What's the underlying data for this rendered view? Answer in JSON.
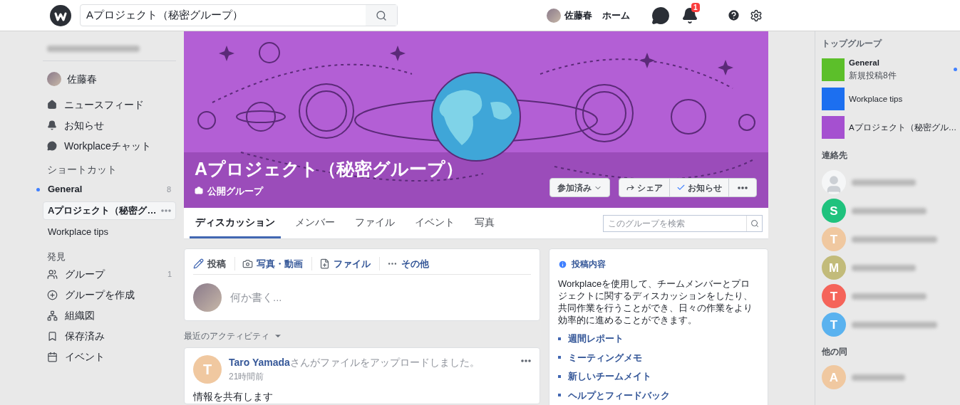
{
  "topbar": {
    "search_value": "Aプロジェクト（秘密グループ）",
    "user_name": "佐藤春",
    "home": "ホーム",
    "notification_badge": "1"
  },
  "sidebar": {
    "user_name": "佐藤春",
    "nav": [
      {
        "label": "ニュースフィード"
      },
      {
        "label": "お知らせ"
      },
      {
        "label": "Workplaceチャット"
      }
    ],
    "shortcuts_title": "ショートカット",
    "shortcuts": [
      {
        "label": "General",
        "count": "8",
        "unread": true,
        "selected": false
      },
      {
        "label": "Aプロジェクト（秘密グ…",
        "unread": false,
        "selected": true
      },
      {
        "label": "Workplace tips",
        "unread": false,
        "selected": false
      }
    ],
    "discover_title": "発見",
    "discover": [
      {
        "label": "グループ",
        "count": "1"
      },
      {
        "label": "グループを作成"
      },
      {
        "label": "組織図"
      },
      {
        "label": "保存済み"
      },
      {
        "label": "イベント"
      }
    ]
  },
  "group": {
    "title": "Aプロジェクト（秘密グループ）",
    "privacy": "公開グループ",
    "joined_button": "参加済み",
    "share_button": "シェア",
    "notify_button": "お知らせ",
    "tabs": [
      {
        "label": "ディスカッション",
        "selected": true
      },
      {
        "label": "メンバー",
        "selected": false
      },
      {
        "label": "ファイル",
        "selected": false
      },
      {
        "label": "イベント",
        "selected": false
      },
      {
        "label": "写真",
        "selected": false
      }
    ],
    "search_placeholder": "このグループを検索"
  },
  "composer": {
    "actions": [
      {
        "label": "投稿",
        "selected": true
      },
      {
        "label": "写真・動画",
        "selected": false
      },
      {
        "label": "ファイル",
        "selected": false
      },
      {
        "label": "その他",
        "selected": false
      }
    ],
    "placeholder": "何か書く..."
  },
  "activity_label": "最近のアクティビティ",
  "post": {
    "avatar_letter": "T",
    "color": "#f0c8a0",
    "author": "Taro Yamada",
    "action": "さんがファイルをアップロードしました。",
    "time": "21時間前",
    "body": "情報を共有します"
  },
  "about": {
    "title": "投稿内容",
    "description": "Workplaceを使用して、チームメンバーとプロジェクトに関するディスカッションをしたり、共同作業を行うことができ、日々の作業をより効率的に進めることができます。",
    "links": [
      "週間レポート",
      "ミーティングメモ",
      "新しいチームメイト",
      "ヘルプとフィードバック"
    ]
  },
  "right": {
    "top_groups_title": "トップグループ",
    "groups": [
      {
        "name": "General",
        "subtitle": "新規投稿8件",
        "unread": true,
        "color": "#5cbf2a"
      },
      {
        "name": "Workplace tips",
        "unread": false,
        "color": "#1c6ff0"
      },
      {
        "name": "Aプロジェクト（秘密グル…",
        "unread": false,
        "color": "#a550d0"
      }
    ],
    "contacts_title": "連絡先",
    "contacts": [
      {
        "kind": "silhouette"
      },
      {
        "kind": "letter",
        "letter": "S",
        "color": "#1fc27d"
      },
      {
        "kind": "letter",
        "letter": "T",
        "color": "#f0c8a0"
      },
      {
        "kind": "letter",
        "letter": "M",
        "color": "#c2bb7a"
      },
      {
        "kind": "letter",
        "letter": "T",
        "color": "#f5645a"
      },
      {
        "kind": "letter",
        "letter": "T",
        "color": "#5ab2ef"
      }
    ],
    "others_title": "他の同",
    "others": [
      {
        "kind": "letter",
        "letter": "A",
        "color": "#f0c8a0"
      }
    ]
  }
}
